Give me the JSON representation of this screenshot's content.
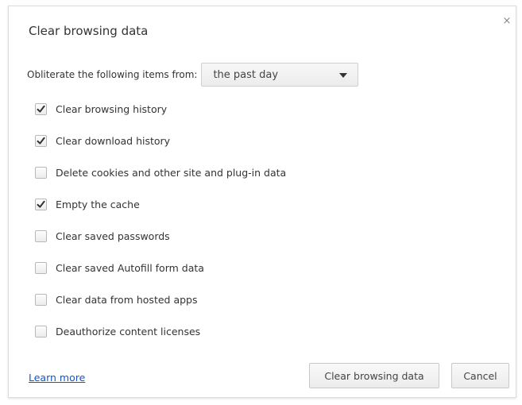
{
  "dialog": {
    "title": "Clear browsing data",
    "close_glyph": "×",
    "period_label": "Obliterate the following items from:",
    "period_value": "the past day",
    "options": [
      {
        "label": "Clear browsing history",
        "checked": true
      },
      {
        "label": "Clear download history",
        "checked": true
      },
      {
        "label": "Delete cookies and other site and plug-in data",
        "checked": false
      },
      {
        "label": "Empty the cache",
        "checked": true
      },
      {
        "label": "Clear saved passwords",
        "checked": false
      },
      {
        "label": "Clear saved Autofill form data",
        "checked": false
      },
      {
        "label": "Clear data from hosted apps",
        "checked": false
      },
      {
        "label": "Deauthorize content licenses",
        "checked": false
      }
    ],
    "learn_more": "Learn more",
    "clear_button": "Clear browsing data",
    "cancel_button": "Cancel"
  },
  "colors": {
    "link": "#1155cc",
    "checkmark": "#333333"
  }
}
